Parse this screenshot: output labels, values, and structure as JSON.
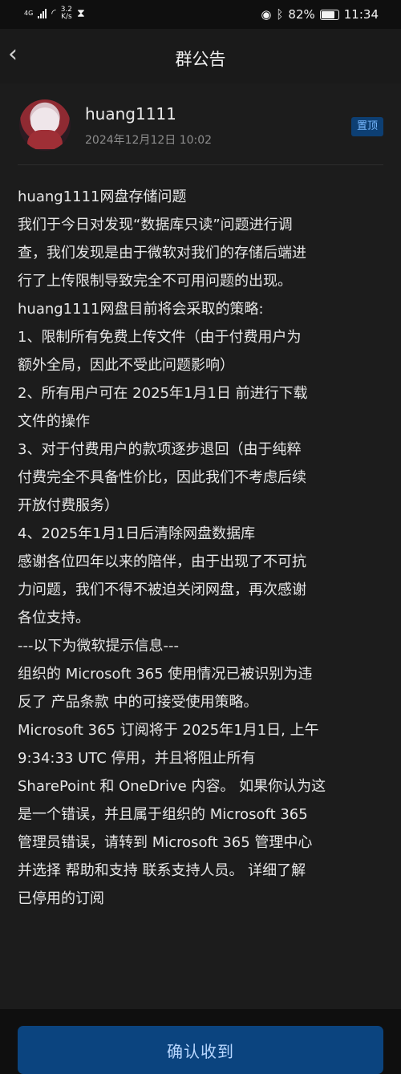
{
  "statusbar": {
    "network": "4G",
    "speed_value": "3.2",
    "speed_unit": "K/s",
    "battery": "82%",
    "time": "11:34"
  },
  "header": {
    "title": "群公告"
  },
  "post": {
    "author": "huang1111",
    "date": "2024年12月12日 10:02",
    "pin_label": "置顶",
    "body": "huang1111网盘存储问题\n我们于今日对发现“数据库只读”问题进行调\n查，我们发现是由于微软对我们的存储后端进\n行了上传限制导致完全不可用问题的出现。\nhuang1111网盘目前将会采取的策略:\n1、限制所有免费上传文件（由于付费用户为\n额外全局，因此不受此问题影响）\n2、所有用户可在 2025年1月1日 前进行下载\n文件的操作\n3、对于付费用户的款项逐步退回（由于纯粹\n付费完全不具备性价比，因此我们不考虑后续\n开放付费服务）\n4、2025年1月1日后清除网盘数据库\n感谢各位四年以来的陪伴，由于出现了不可抗\n力问题，我们不得不被迫关闭网盘，再次感谢\n各位支持。\n---以下为微软提示信息---\n组织的 Microsoft 365 使用情况已被识别为违\n反了 产品条款 中的可接受使用策略。\nMicrosoft 365 订阅将于 2025年1月1日, 上午\n9:34:33 UTC 停用，并且将阻止所有\nSharePoint 和 OneDrive 内容。 如果你认为这\n是一个错误，并且属于组织的 Microsoft 365\n管理员错误，请转到 Microsoft 365 管理中心\n并选择 帮助和支持 联系支持人员。 详细了解\n已停用的订阅"
  },
  "actions": {
    "confirm_label": "确认收到"
  }
}
